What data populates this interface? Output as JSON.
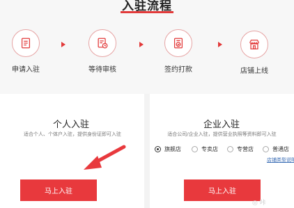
{
  "page": {
    "title": "入驻流程"
  },
  "steps": [
    {
      "label": "申请入驻",
      "icon": "application-form-icon"
    },
    {
      "label": "等待审核",
      "icon": "pending-review-icon"
    },
    {
      "label": "签约打款",
      "icon": "contract-payment-icon"
    },
    {
      "label": "店铺上线",
      "icon": "storefront-icon"
    }
  ],
  "individual": {
    "title": "个人入驻",
    "desc": "适合个人、个体户入驻，提供身份证即可入驻",
    "button": "马上入驻"
  },
  "enterprise": {
    "title": "企业入驻",
    "desc": "适合公司/企业入驻，提供营业执照等资料即可入驻",
    "options": [
      {
        "label": "旗舰店",
        "checked": true
      },
      {
        "label": "专卖店",
        "checked": false
      },
      {
        "label": "专营店",
        "checked": false
      },
      {
        "label": "普通店",
        "checked": false
      }
    ],
    "link": "店铺类型说明",
    "button": "马上入驻"
  },
  "watermark": "◎ 咔",
  "colors": {
    "accent": "#e8393d",
    "icon_border": "#e6a3a3",
    "link": "#3d6fb6"
  }
}
